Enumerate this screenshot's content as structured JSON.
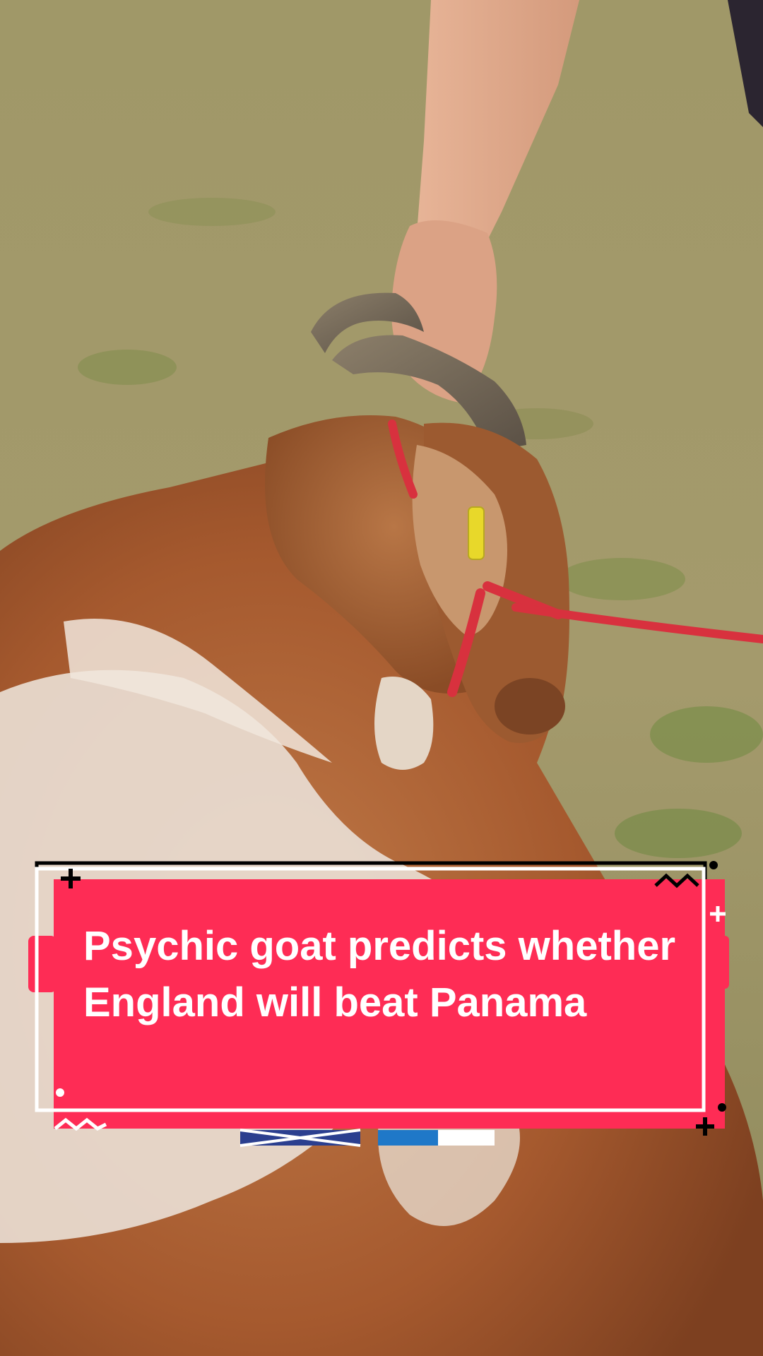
{
  "headline": {
    "text": "Psychic goat predicts whether England will beat Panama"
  },
  "colors": {
    "card": "#fe2c55",
    "text": "#ffffff",
    "frame": "#000000"
  }
}
